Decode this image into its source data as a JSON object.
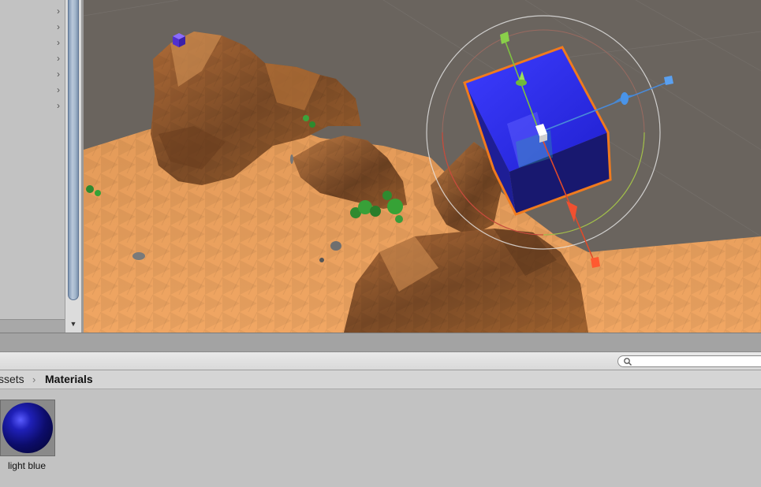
{
  "hierarchy": {
    "expand_arrows": [
      "›",
      "›",
      "›",
      "›",
      "›",
      "›",
      "›"
    ]
  },
  "scrollbar": {
    "down_arrow": "▼"
  },
  "scene": {
    "selected_object": "cube",
    "gizmo": "move-rotate",
    "colors": {
      "sky": "#6a645e",
      "terrain": "#d4874a",
      "cube": "#2b2bf0",
      "selection_outline": "#f07a1e"
    }
  },
  "project": {
    "search": {
      "value": "",
      "placeholder": ""
    },
    "breadcrumb": {
      "parent": "ssets",
      "separator": "›",
      "current": "Materials"
    },
    "assets": [
      {
        "name": "light blue",
        "type": "material",
        "color": "#1f20b8"
      }
    ]
  }
}
